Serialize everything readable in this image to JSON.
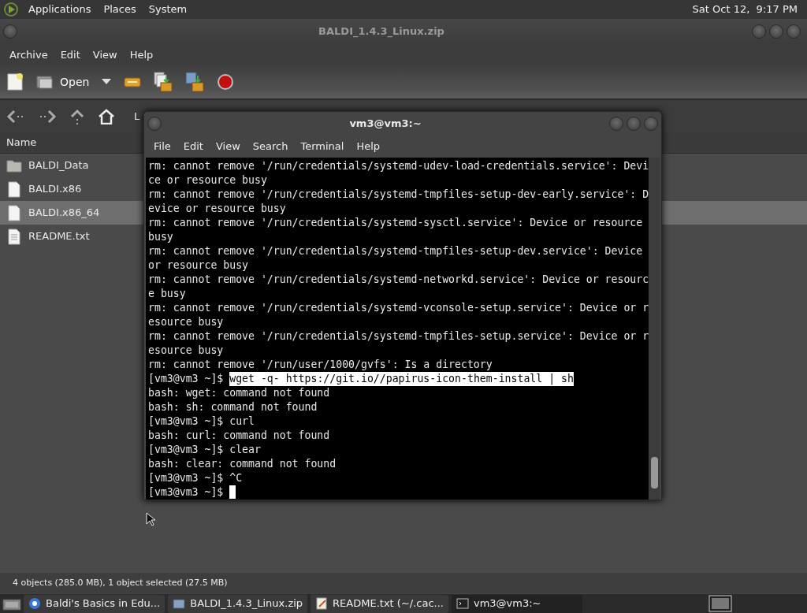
{
  "top_panel": {
    "menus": [
      "Applications",
      "Places",
      "System"
    ],
    "clock": "Sat Oct 12,  9:17 PM"
  },
  "archive_window": {
    "title": "BALDI_1.4.3_Linux.zip",
    "menu": [
      "Archive",
      "Edit",
      "View",
      "Help"
    ],
    "toolbar": {
      "open_label": "Open"
    },
    "location_label": "L",
    "list_header": "Name",
    "files": [
      {
        "name": "BALDI_Data",
        "kind": "folder",
        "selected": false
      },
      {
        "name": "BALDI.x86",
        "kind": "file",
        "selected": false
      },
      {
        "name": "BALDI.x86_64",
        "kind": "file",
        "selected": true
      },
      {
        "name": "README.txt",
        "kind": "text",
        "selected": false
      }
    ],
    "status_bar": "4 objects (285.0 MB), 1 object selected (27.5 MB)"
  },
  "terminal_window": {
    "title": "vm3@vm3:~",
    "menu": [
      "File",
      "Edit",
      "View",
      "Search",
      "Terminal",
      "Help"
    ],
    "lines": [
      {
        "kind": "output",
        "text": "rm: cannot remove '/run/credentials/systemd-udev-load-credentials.service': Devi"
      },
      {
        "kind": "output",
        "text": "ce or resource busy"
      },
      {
        "kind": "output",
        "text": "rm: cannot remove '/run/credentials/systemd-tmpfiles-setup-dev-early.service': D"
      },
      {
        "kind": "output",
        "text": "evice or resource busy"
      },
      {
        "kind": "output",
        "text": "rm: cannot remove '/run/credentials/systemd-sysctl.service': Device or resource"
      },
      {
        "kind": "output",
        "text": "busy"
      },
      {
        "kind": "output",
        "text": "rm: cannot remove '/run/credentials/systemd-tmpfiles-setup-dev.service': Device"
      },
      {
        "kind": "output",
        "text": "or resource busy"
      },
      {
        "kind": "output",
        "text": "rm: cannot remove '/run/credentials/systemd-networkd.service': Device or resourc"
      },
      {
        "kind": "output",
        "text": "e busy"
      },
      {
        "kind": "output",
        "text": "rm: cannot remove '/run/credentials/systemd-vconsole-setup.service': Device or r"
      },
      {
        "kind": "output",
        "text": "esource busy"
      },
      {
        "kind": "output",
        "text": "rm: cannot remove '/run/credentials/systemd-tmpfiles-setup.service': Device or r"
      },
      {
        "kind": "output",
        "text": "esource busy"
      },
      {
        "kind": "output",
        "text": "rm: cannot remove '/run/user/1000/gvfs': Is a directory"
      },
      {
        "kind": "command",
        "prompt": "[vm3@vm3 ~]$",
        "command": "wget -q- https://git.io//papirus-icon-them-install | sh",
        "highlighted": true
      },
      {
        "kind": "output",
        "text": "bash: wget: command not found"
      },
      {
        "kind": "output",
        "text": "bash: sh: command not found"
      },
      {
        "kind": "command",
        "prompt": "[vm3@vm3 ~]$",
        "command": "curl",
        "highlighted": false
      },
      {
        "kind": "output",
        "text": "bash: curl: command not found"
      },
      {
        "kind": "command",
        "prompt": "[vm3@vm3 ~]$",
        "command": "clear",
        "highlighted": false
      },
      {
        "kind": "output",
        "text": "bash: clear: command not found"
      },
      {
        "kind": "command",
        "prompt": "[vm3@vm3 ~]$",
        "command": "^C",
        "highlighted": false
      },
      {
        "kind": "input",
        "prompt": "[vm3@vm3 ~]$"
      }
    ]
  },
  "taskbar": {
    "tasks": [
      {
        "label": "Baldi's Basics in Edu...",
        "kind": "browser",
        "selected": false
      },
      {
        "label": "BALDI_1.4.3_Linux.zip",
        "kind": "archive",
        "selected": false
      },
      {
        "label": "README.txt (~/.cac...",
        "kind": "editor",
        "selected": false
      },
      {
        "label": "vm3@vm3:~",
        "kind": "terminal",
        "selected": true
      }
    ]
  }
}
